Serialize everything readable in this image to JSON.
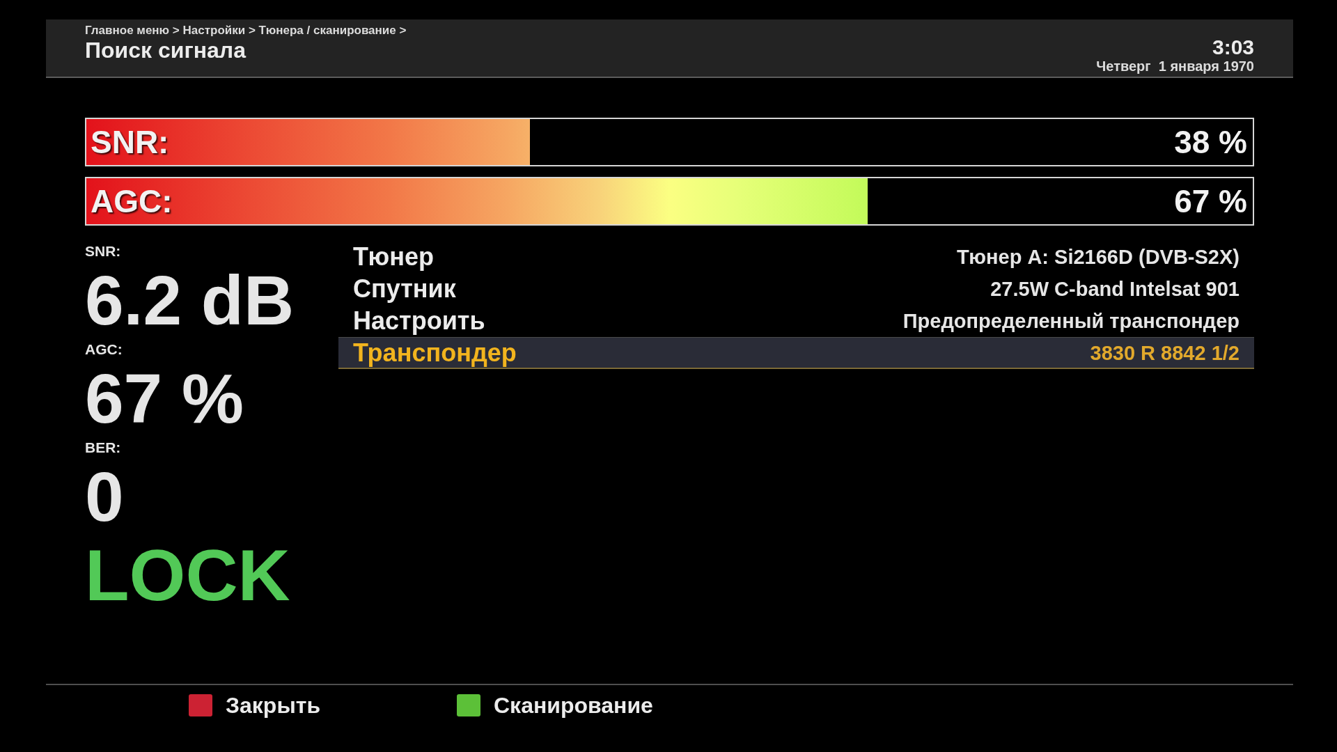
{
  "header": {
    "breadcrumb": "Главное меню > Настройки > Тюнера / сканирование >",
    "title": "Поиск сигнала",
    "time": "3:03",
    "date": "Четверг  1 января 1970"
  },
  "meters": [
    {
      "label": "SNR:",
      "level": 0.38,
      "reading": "38 %"
    },
    {
      "label": "AGC:",
      "level": 0.67,
      "reading": "67 %"
    }
  ],
  "stats": [
    {
      "label": "SNR:",
      "value": "6.2 dB"
    },
    {
      "label": "AGC:",
      "value": "67 %"
    },
    {
      "label": "BER:",
      "value": "0"
    }
  ],
  "lock_status": {
    "text": "LOCK",
    "locked": true
  },
  "settings": [
    {
      "label": "Тюнер",
      "value": "Тюнер A: Si2166D (DVB-S2X)",
      "selected": false
    },
    {
      "label": "Спутник",
      "value": "27.5W C-band Intelsat 901",
      "selected": false
    },
    {
      "label": "Настроить",
      "value": "Предопределенный транспондер",
      "selected": false
    },
    {
      "label": "Транспондер",
      "value": "3830 R 8842 1/2",
      "selected": true
    }
  ],
  "color_keys": [
    {
      "label": "Закрыть",
      "color": "#cc2233"
    },
    {
      "label": "Сканирование",
      "color": "#5cc038"
    }
  ]
}
